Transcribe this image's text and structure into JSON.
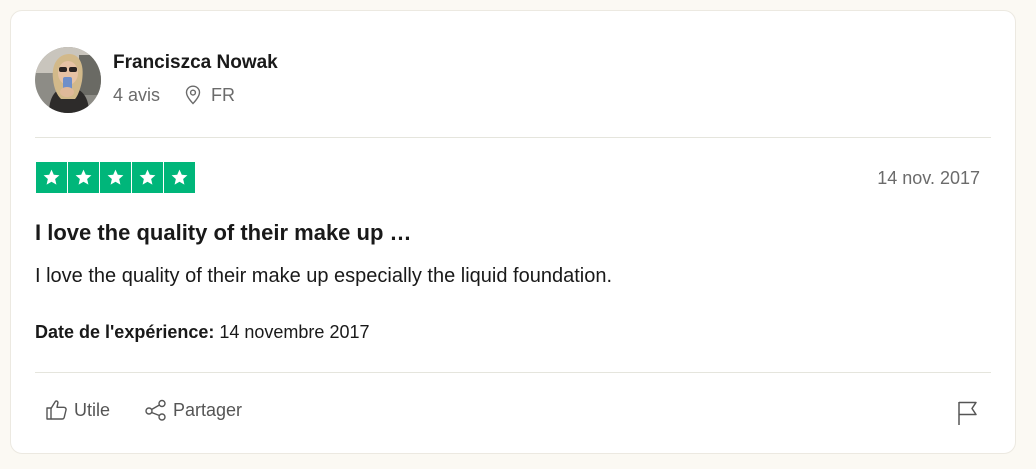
{
  "reviewer": {
    "name": "Franciszca Nowak",
    "reviews_count": "4 avis",
    "country": "FR"
  },
  "review": {
    "rating": 5,
    "date": "14 nov. 2017",
    "title": "I love the quality of their make up …",
    "body": "I love the quality of their make up especially the liquid foundation.",
    "experience_label": "Date de l'expérience:",
    "experience_date": "14 novembre 2017"
  },
  "actions": {
    "useful_label": "Utile",
    "share_label": "Partager"
  },
  "icons": {
    "location": "map-pin-icon",
    "useful": "thumbs-up-icon",
    "share": "share-icon",
    "report": "flag-icon",
    "rating": "star-icon"
  },
  "colors": {
    "star_green": "#00b67a",
    "page_background": "#fbf9f3",
    "secondary_text": "#6b6b6b"
  }
}
